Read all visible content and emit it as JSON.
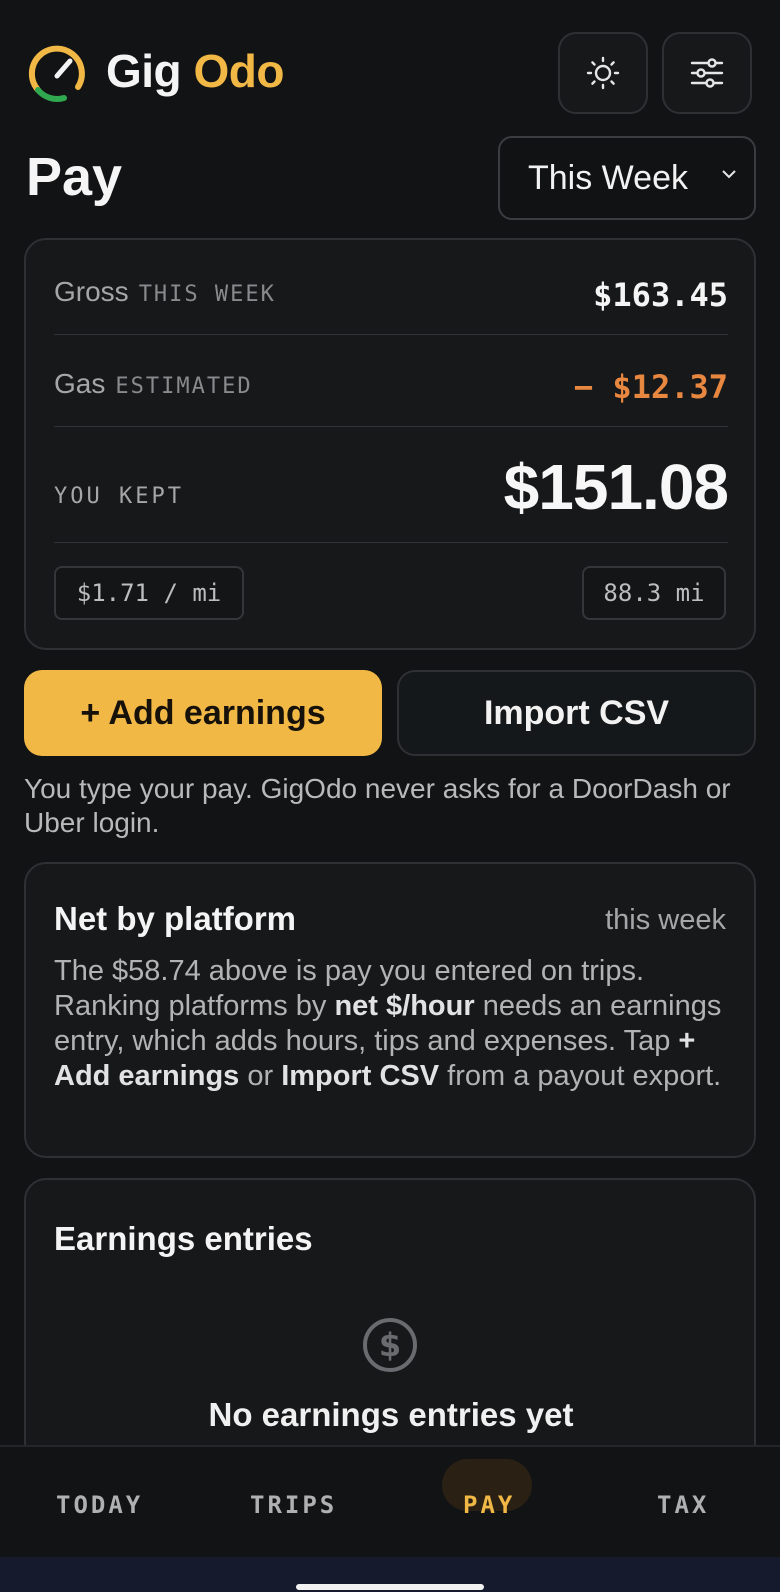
{
  "header": {
    "brand_part1": "Gig",
    "brand_part2": "Odo",
    "theme_icon": "sun-icon",
    "settings_icon": "sliders-icon"
  },
  "page": {
    "title": "Pay",
    "period_selected": "This Week"
  },
  "summary": {
    "gross_label": "Gross",
    "gross_sub": "THIS WEEK",
    "gross_value": "$163.45",
    "gas_label": "Gas",
    "gas_sub": "ESTIMATED",
    "gas_value": "− $12.37",
    "kept_label": "YOU KEPT",
    "kept_value": "$151.08",
    "per_mile": "$1.71 / mi",
    "miles": "88.3 mi"
  },
  "actions": {
    "add_label": "+ Add earnings",
    "import_label": "Import CSV",
    "note": "You type your pay. GigOdo never asks for a DoorDash or Uber login."
  },
  "platform_card": {
    "title": "Net by platform",
    "period": "this week",
    "text1": "The $58.74 above is pay you entered on trips. Ranking platforms by ",
    "bold1": "net $/hour",
    "text2": " needs an earnings entry, which adds hours, tips and expenses. Tap ",
    "bold2": "+ Add earnings",
    "text3": " or ",
    "bold3": "Import CSV",
    "text4": " from a payout export."
  },
  "entries_card": {
    "title": "Earnings entries",
    "empty_icon": "dollar-icon",
    "empty_title": "No earnings entries yet"
  },
  "nav": {
    "today": "TODAY",
    "trips": "TRIPS",
    "pay": "PAY",
    "tax": "TAX"
  },
  "colors": {
    "accent": "#f2b846",
    "expense": "#e8873f",
    "background": "#121314",
    "card": "#17181a"
  }
}
